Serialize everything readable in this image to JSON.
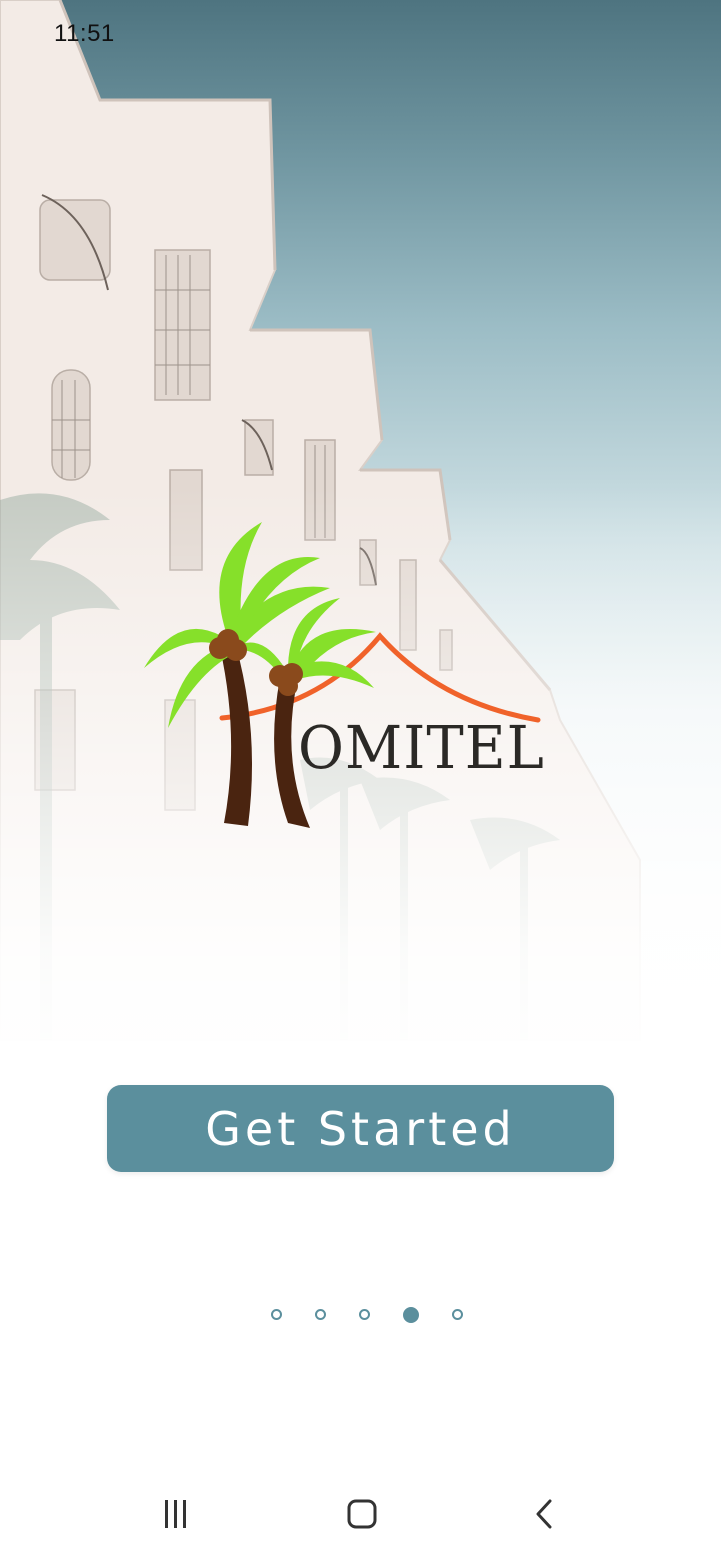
{
  "status_bar": {
    "time": "11:51"
  },
  "logo": {
    "text": "OMITEL",
    "colors": {
      "palm_leaves": "#86e02a",
      "palm_trunk": "#4a2410",
      "coconut": "#8a4a1c",
      "roof": "#f0622a",
      "text": "#2b2926"
    }
  },
  "cta": {
    "label": "Get Started",
    "color": "#5b8f9d"
  },
  "pager": {
    "total": 5,
    "active_index": 3
  },
  "nav_bar": {
    "recents_icon": "recents-icon",
    "home_icon": "home-icon",
    "back_icon": "back-icon"
  }
}
